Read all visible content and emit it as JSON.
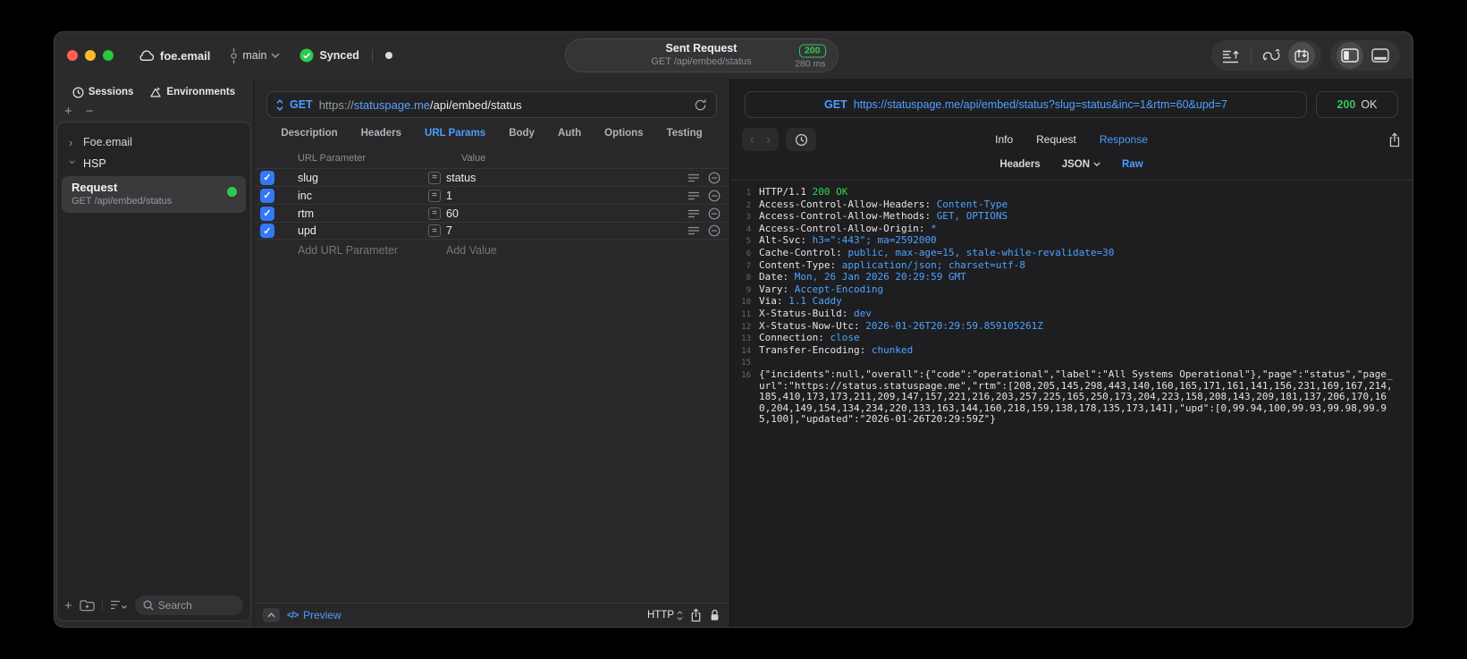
{
  "colors": {
    "accent_blue": "#4b9eff",
    "success_green": "#32d74b",
    "checkbox_blue": "#3478f6",
    "badge_green": "#34c759"
  },
  "titlebar": {
    "project": "foe.email",
    "branch": "main",
    "sync_label": "Synced",
    "request_title": "Sent Request",
    "request_subtitle": "GET /api/embed/status",
    "status_code": "200",
    "duration": "280 ms"
  },
  "sidebar": {
    "tabs": [
      {
        "label": "Sessions"
      },
      {
        "label": "Environments"
      }
    ],
    "tree": [
      {
        "label": "Foe.email"
      },
      {
        "label": "HSP"
      }
    ],
    "request_item": {
      "title": "Request",
      "subtitle": "GET /api/embed/status"
    },
    "search_placeholder": "Search"
  },
  "request_pane": {
    "method": "GET",
    "url": {
      "scheme": "https://",
      "host": "statuspage.me",
      "path": "/api/embed/status"
    },
    "tabs": [
      "Description",
      "Headers",
      "URL Params",
      "Body",
      "Auth",
      "Options",
      "Testing"
    ],
    "active_tab": "URL Params",
    "table": {
      "columns": [
        "URL Parameter",
        "Value"
      ],
      "rows": [
        {
          "enabled": true,
          "name": "slug",
          "value": "status"
        },
        {
          "enabled": true,
          "name": "inc",
          "value": "1"
        },
        {
          "enabled": true,
          "name": "rtm",
          "value": "60"
        },
        {
          "enabled": true,
          "name": "upd",
          "value": "7"
        }
      ],
      "add_name": "Add URL Parameter",
      "add_value": "Add Value"
    },
    "footer": {
      "code_glyph": "</>",
      "preview": "Preview",
      "protocol": "HTTP"
    }
  },
  "response_pane": {
    "method": "GET",
    "url": "https://statuspage.me/api/embed/status?slug=status&inc=1&rtm=60&upd=7",
    "status_code": "200",
    "status_text": "OK",
    "tabs": [
      "Info",
      "Request",
      "Response"
    ],
    "active_tab": "Response",
    "subtabs": [
      "Headers",
      "JSON",
      "Raw"
    ],
    "active_subtab": "Raw",
    "status_line": {
      "protocol": "HTTP/1.1",
      "status": "200 OK"
    },
    "headers": [
      {
        "name": "Access-Control-Allow-Headers",
        "value": "Content-Type"
      },
      {
        "name": "Access-Control-Allow-Methods",
        "value": "GET, OPTIONS"
      },
      {
        "name": "Access-Control-Allow-Origin",
        "value": "*"
      },
      {
        "name": "Alt-Svc",
        "value": "h3=\":443\"; ma=2592000"
      },
      {
        "name": "Cache-Control",
        "value": "public, max-age=15, stale-while-revalidate=30"
      },
      {
        "name": "Content-Type",
        "value": "application/json; charset=utf-8"
      },
      {
        "name": "Date",
        "value": "Mon, 26 Jan 2026 20:29:59 GMT"
      },
      {
        "name": "Vary",
        "value": "Accept-Encoding"
      },
      {
        "name": "Via",
        "value": "1.1 Caddy"
      },
      {
        "name": "X-Status-Build",
        "value": "dev"
      },
      {
        "name": "X-Status-Now-Utc",
        "value": "2026-01-26T20:29:59.859105261Z"
      },
      {
        "name": "Connection",
        "value": "close"
      },
      {
        "name": "Transfer-Encoding",
        "value": "chunked"
      }
    ],
    "body": "{\"incidents\":null,\"overall\":{\"code\":\"operational\",\"label\":\"All Systems Operational\"},\"page\":\"status\",\"page_url\":\"https://status.statuspage.me\",\"rtm\":[208,205,145,298,443,140,160,165,171,161,141,156,231,169,167,214,185,410,173,173,211,209,147,157,221,216,203,257,225,165,250,173,204,223,158,208,143,209,181,137,206,170,160,204,149,154,134,234,220,133,163,144,160,218,159,138,178,135,173,141],\"upd\":[0,99.94,100,99.93,99.98,99.95,100],\"updated\":\"2026-01-26T20:29:59Z\"}"
  }
}
